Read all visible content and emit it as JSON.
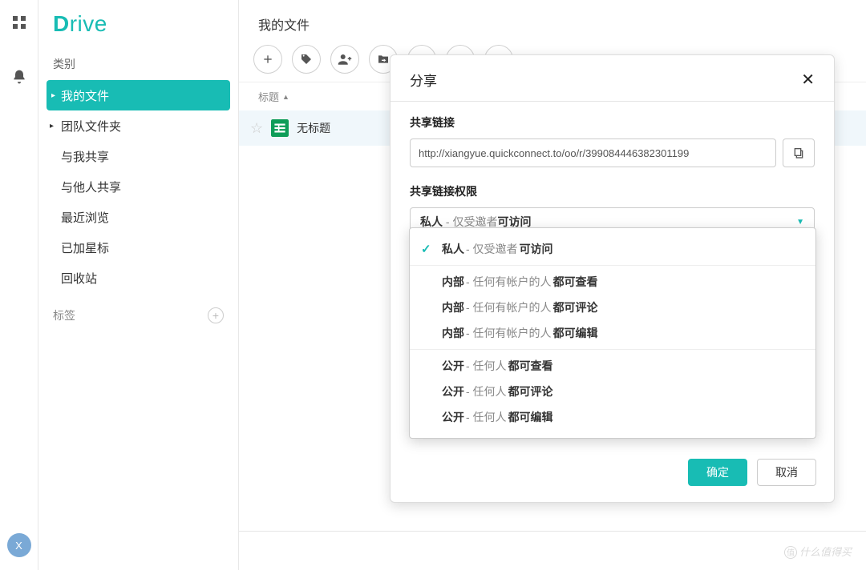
{
  "app": {
    "logo": "Drive"
  },
  "leftRail": {
    "avatarLetter": "X"
  },
  "sidebar": {
    "sectionCategories": "类别",
    "items": [
      "我的文件",
      "团队文件夹",
      "与我共享",
      "与他人共享",
      "最近浏览",
      "已加星标",
      "回收站"
    ],
    "sectionLabels": "标签"
  },
  "main": {
    "title": "我的文件",
    "tableHeader": "标题",
    "file": {
      "name": "无标题"
    }
  },
  "modal": {
    "title": "分享",
    "shareLinkLabel": "共享链接",
    "linkValue": "http://xiangyue.quickconnect.to/oo/r/399084446382301199",
    "permLabel": "共享链接权限",
    "selected": {
      "bold1": "私人",
      "muted": " - 仅受邀者",
      "bold2": "可访问"
    },
    "confirm": "确定",
    "cancel": "取消"
  },
  "dropdown": {
    "groups": [
      [
        {
          "b1": "私人",
          "m": " - 仅受邀者",
          "b2": "可访问",
          "selected": true
        }
      ],
      [
        {
          "b1": "内部",
          "m": " - 任何有帐户的人",
          "b2": "都可查看"
        },
        {
          "b1": "内部",
          "m": " - 任何有帐户的人",
          "b2": "都可评论"
        },
        {
          "b1": "内部",
          "m": " - 任何有帐户的人",
          "b2": "都可编辑"
        }
      ],
      [
        {
          "b1": "公开",
          "m": " - 任何人",
          "b2": "都可查看"
        },
        {
          "b1": "公开",
          "m": " - 任何人",
          "b2": "都可评论"
        },
        {
          "b1": "公开",
          "m": " - 任何人",
          "b2": "都可编辑"
        }
      ]
    ]
  },
  "watermark": "什么值得买"
}
